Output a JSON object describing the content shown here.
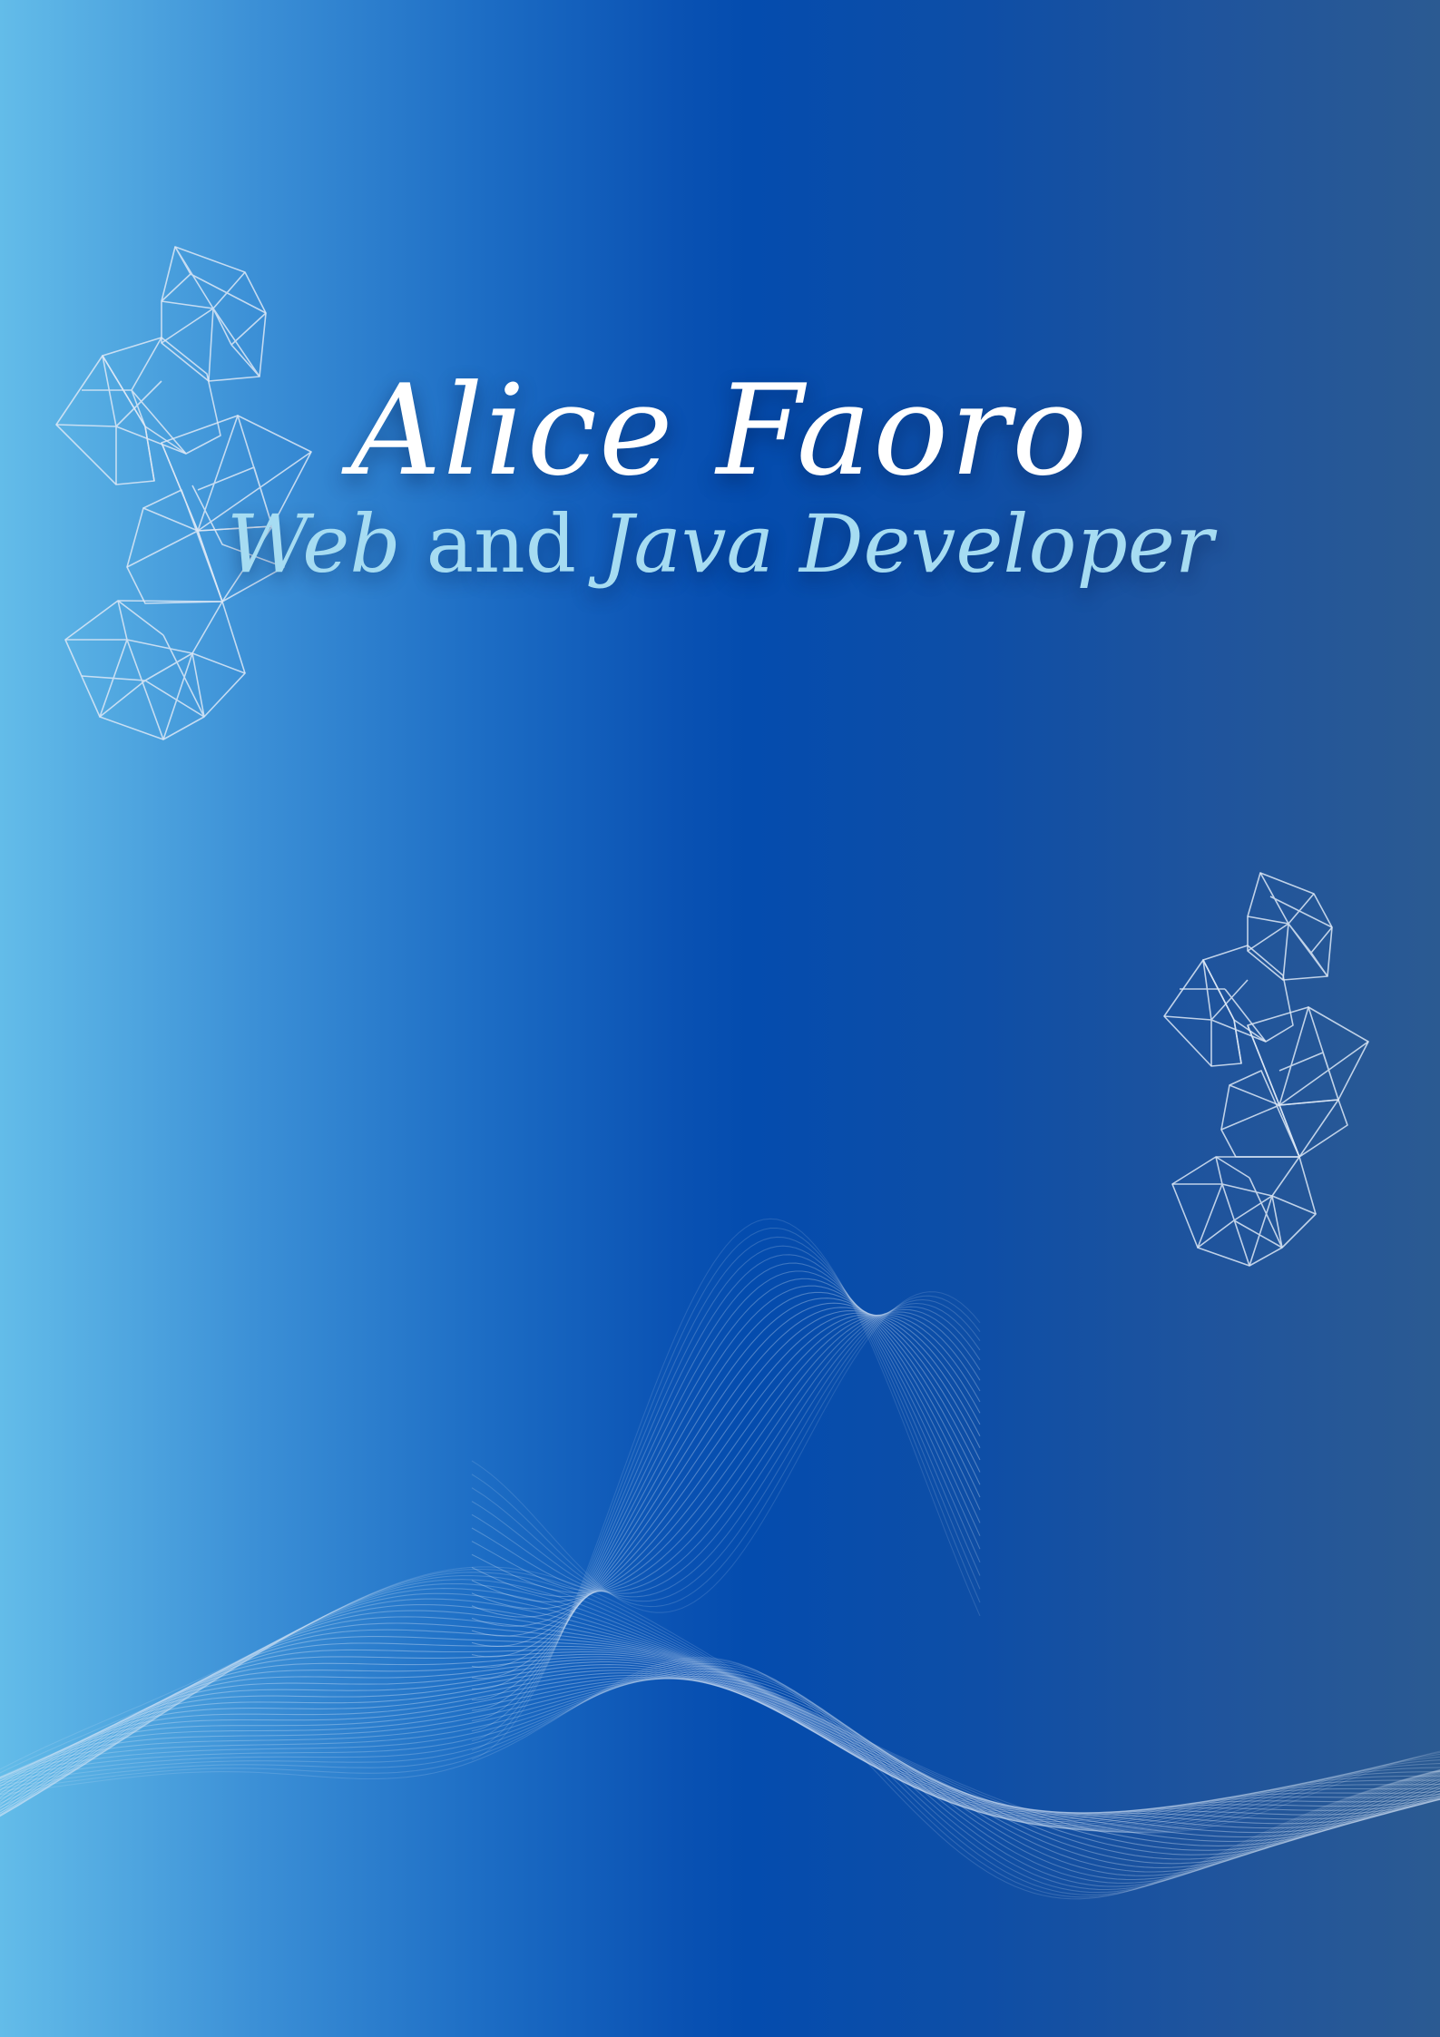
{
  "cover": {
    "name": "Alice Faoro",
    "role": {
      "part1": "Web",
      "part2": " and ",
      "part3": "Java Developer"
    }
  },
  "decorations": {
    "left_mesh": "polygon-mesh-decoration",
    "right_mesh": "polygon-mesh-decoration",
    "bottom_waves": "wave-lines-decoration"
  },
  "colors": {
    "gradient_light": "#63bce9",
    "gradient_mid": "#044cae",
    "gradient_dark": "#2b5a92",
    "name_color": "#ffffff",
    "role_color": "#a6dcf2"
  }
}
